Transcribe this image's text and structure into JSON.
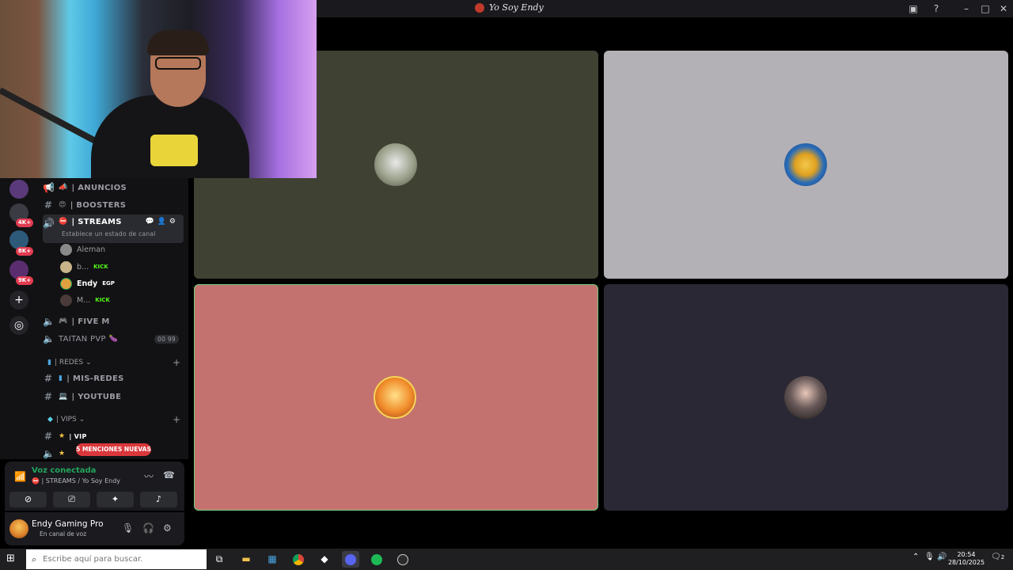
{
  "window": {
    "title": "Yo Soy Endy"
  },
  "rail": {
    "badges": [
      "4K+",
      "8K+",
      "9K+"
    ]
  },
  "channels": {
    "anuncios": "| ANUNCIOS",
    "boosters": "| BOOSTERS",
    "streams": {
      "name": "| STREAMS",
      "status_placeholder": "Establece un estado de canal",
      "users": [
        {
          "name": "Aleman",
          "tag": ""
        },
        {
          "name": "b...",
          "tag": "KICK"
        },
        {
          "name": "Endy",
          "tag": "EGP"
        },
        {
          "name": "M...",
          "tag": "KICK"
        }
      ]
    },
    "five_m": "| FIVE M",
    "taitan": {
      "name": "TAITAN PVP",
      "count_a": "00",
      "count_b": "99"
    },
    "cat_redes": "| REDES",
    "mis_redes": "| MIS-REDES",
    "youtube": "| YOUTUBE",
    "cat_vips": "| VIPS",
    "vip": "| VIP",
    "mentions": "5 MENCIONES NUEVAS"
  },
  "voice_panel": {
    "status": "Voz conectada",
    "channel": "| STREAMS / Yo Soy Endy"
  },
  "user_panel": {
    "name": "Endy Gaming Pro",
    "status": "En canal de voz"
  },
  "tiles": [
    {
      "bg": "#3f4233"
    },
    {
      "bg": "#b4b1b6"
    },
    {
      "bg": "#c4726f"
    },
    {
      "bg": "#2a2834"
    }
  ],
  "colors": {
    "connected": "#23a55a",
    "mention_badge": "#da373c",
    "kick_green": "#53fc18",
    "speaking_border": "#6fcf7a"
  },
  "taskbar": {
    "search_placeholder": "Escribe aquí para buscar.",
    "time": "20:54",
    "date": "28/10/2025",
    "notifications": "2"
  }
}
